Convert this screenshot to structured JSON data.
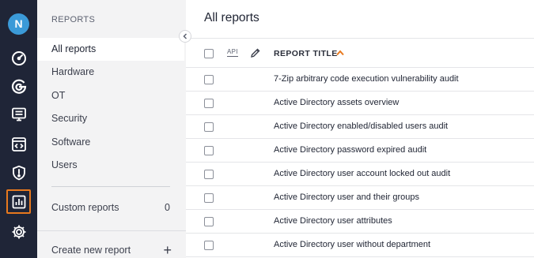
{
  "user": {
    "initial": "N"
  },
  "rail": {
    "icons": [
      "dashboard-gauge-icon",
      "reports-g-icon",
      "monitor-list-icon",
      "code-window-icon",
      "shield-alert-icon",
      "bar-chart-report-icon",
      "settings-gear-icon"
    ],
    "active": "bar-chart-report-icon",
    "active_color": "#e8791e",
    "bg_color": "#1f2537"
  },
  "nav": {
    "header": "REPORTS",
    "items": [
      {
        "label": "All reports"
      },
      {
        "label": "Hardware"
      },
      {
        "label": "OT"
      },
      {
        "label": "Security"
      },
      {
        "label": "Software"
      },
      {
        "label": "Users"
      }
    ],
    "custom": {
      "label": "Custom reports",
      "count": "0"
    },
    "create": {
      "label": "Create new report"
    }
  },
  "main": {
    "title": "All reports",
    "columns": {
      "api": "API",
      "title": "REPORT TITLE"
    },
    "sort": {
      "direction": "ascending",
      "color": "#e8791e"
    },
    "rows": [
      "7-Zip arbitrary code execution vulnerability audit",
      "Active Directory assets overview",
      "Active Directory enabled/disabled users audit",
      "Active Directory password expired audit",
      "Active Directory user account locked out audit",
      "Active Directory user and their groups",
      "Active Directory user attributes",
      "Active Directory user without department"
    ]
  }
}
